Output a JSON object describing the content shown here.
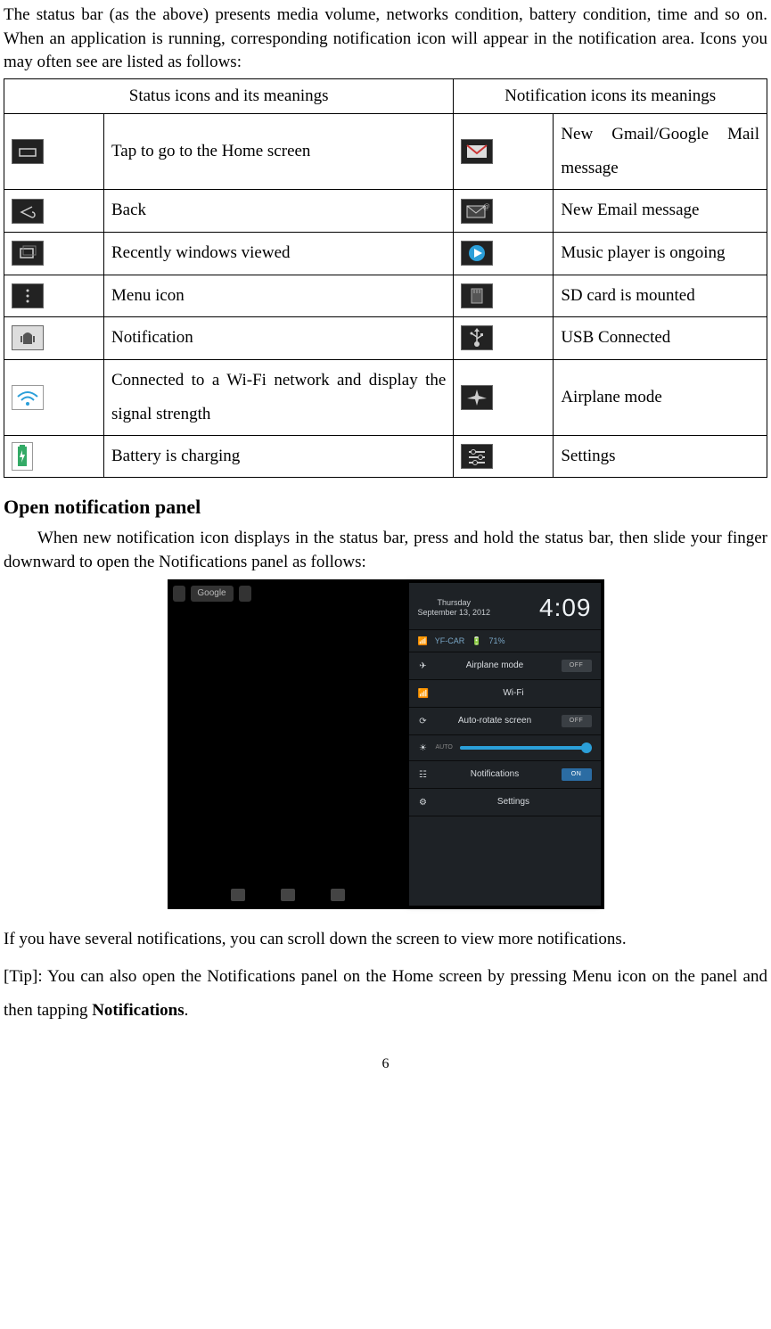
{
  "intro": "The status bar (as the above) presents media volume, networks condition, battery condition, time and so on. When an application is running, corresponding notification icon will appear in the notification area. Icons you may often see are listed as follows:",
  "table": {
    "head_left": "Status icons and its meanings",
    "head_right": "Notification icons its meanings",
    "rows": [
      {
        "l_icon": "home-icon",
        "l_text": "Tap to go to the Home screen",
        "r_icon": "gmail-icon",
        "r_text": "New Gmail/Google Mail message"
      },
      {
        "l_icon": "back-icon",
        "l_text": "Back",
        "r_icon": "email-icon",
        "r_text": "New Email message"
      },
      {
        "l_icon": "recent-icon",
        "l_text": "Recently windows viewed",
        "r_icon": "play-icon",
        "r_text": "Music player is ongoing"
      },
      {
        "l_icon": "menu-icon",
        "l_text": "Menu icon",
        "r_icon": "sd-icon",
        "r_text": "SD card is mounted"
      },
      {
        "l_icon": "android-icon",
        "l_text": "Notification",
        "r_icon": "usb-icon",
        "r_text": "USB Connected"
      },
      {
        "l_icon": "wifi-icon",
        "l_text": "Connected to a Wi-Fi network and display the signal strength",
        "r_icon": "airplane-icon",
        "r_text": "Airplane mode"
      },
      {
        "l_icon": "charging-icon",
        "l_text": "Battery is charging",
        "r_icon": "settings-icon",
        "r_text": "Settings"
      }
    ]
  },
  "section_heading": "Open notification panel",
  "section_p1": "When new notification icon displays in the status bar, press and hold the status bar, then slide your finger downward to open the Notifications panel as follows:",
  "screenshot": {
    "google_label": "Google",
    "day": "Thursday",
    "date": "September 13, 2012",
    "clock": "4:09",
    "wifi_name": "YF-CAR",
    "battery": "71%",
    "rows": {
      "airplane": "Airplane mode",
      "wifi": "Wi-Fi",
      "rotate": "Auto-rotate screen",
      "auto": "AUTO",
      "notifications": "Notifications",
      "settings": "Settings"
    },
    "off": "OFF",
    "on": "ON"
  },
  "after_p1": "If you have several notifications, you can scroll down the screen to view more notifications.",
  "after_p2_a": "[Tip]: You can also open the Notifications panel on the Home screen by pressing Menu icon on the panel and then tapping ",
  "after_p2_bold": "Notifications",
  "after_p2_b": ".",
  "page_number": "6"
}
